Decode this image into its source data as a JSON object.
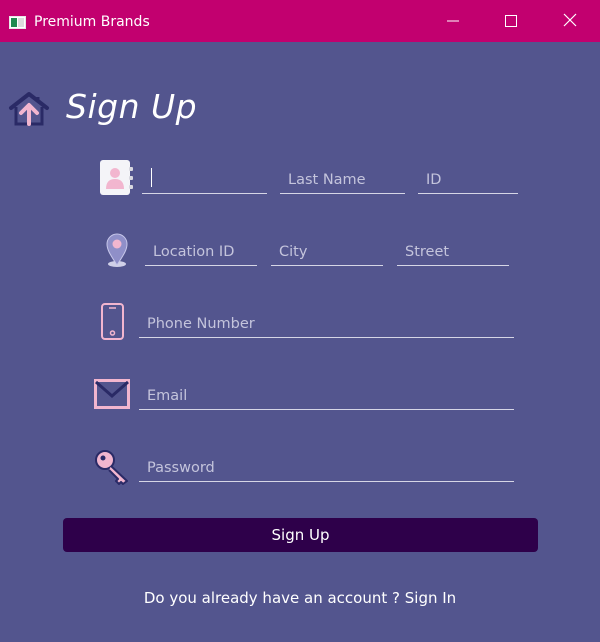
{
  "window": {
    "title": "Premium Brands",
    "title_bar_color": "#c2006f",
    "background_color": "#53558e",
    "controls": {
      "minimize": "minimize-icon",
      "maximize": "maximize-icon",
      "close": "close-icon"
    }
  },
  "header": {
    "back_icon": "home-up-arrow-icon",
    "title": "Sign Up"
  },
  "form": {
    "first_name": {
      "value": "",
      "placeholder": "",
      "icon": "contact-book-icon"
    },
    "last_name": {
      "value": "",
      "placeholder": "Last Name"
    },
    "id": {
      "value": "",
      "placeholder": "ID"
    },
    "location_id": {
      "value": "",
      "placeholder": "Location ID",
      "icon": "map-pin-icon"
    },
    "city": {
      "value": "",
      "placeholder": "City"
    },
    "street": {
      "value": "",
      "placeholder": "Street"
    },
    "phone": {
      "value": "",
      "placeholder": "Phone Number",
      "icon": "phone-icon"
    },
    "email": {
      "value": "",
      "placeholder": "Email",
      "icon": "envelope-icon"
    },
    "password": {
      "value": "",
      "placeholder": "Password",
      "icon": "key-icon"
    }
  },
  "actions": {
    "signup_label": "Sign Up",
    "signup_color": "#2e004a"
  },
  "footer": {
    "prompt": "Do you already have an account ?",
    "link": "Sign In"
  }
}
